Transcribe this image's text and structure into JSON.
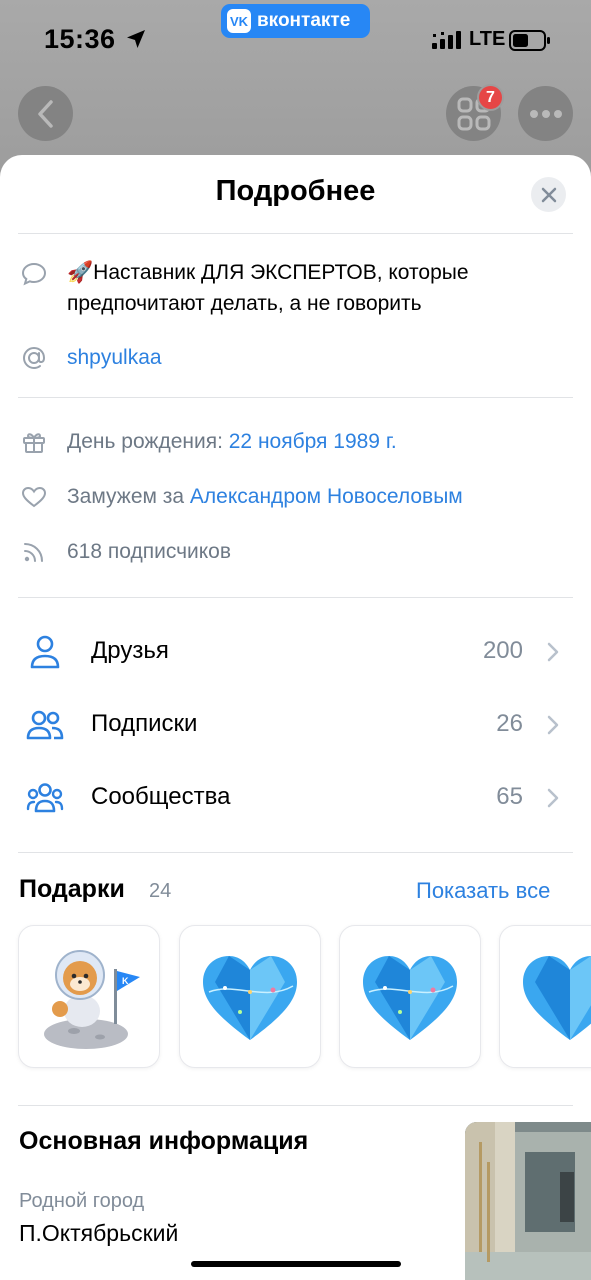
{
  "status_bar": {
    "time": "15:36",
    "vk_logo": "VK",
    "vk_label": "вконтакте",
    "network": "LTE"
  },
  "top_nav": {
    "notifications_count": "7"
  },
  "sheet": {
    "title": "Подробнее",
    "status_text": "🚀Наставник ДЛЯ ЭКСПЕРТОВ, которые предпочитают делать, а не говорить",
    "username": "shpyulkaa",
    "birthday_label": "День рождения: ",
    "birthday_value": "22 ноября 1989 г.",
    "relationship_label": "Замужем за ",
    "relationship_value": "Александром Новоселовым",
    "followers": "618 подписчиков",
    "nav": [
      {
        "label": "Друзья",
        "count": "200"
      },
      {
        "label": "Подписки",
        "count": "26"
      },
      {
        "label": "Сообщества",
        "count": "65"
      }
    ],
    "gifts": {
      "title": "Подарки",
      "count": "24",
      "show_all": "Показать все"
    },
    "main_info": {
      "title": "Основная информация",
      "hometown_label": "Родной город",
      "hometown_value": "П.Октябрьский"
    }
  },
  "colors": {
    "accent": "#2d81e0",
    "vk_blue": "#2787f5",
    "badge_red": "#e64646",
    "secondary_text": "#818c99"
  }
}
